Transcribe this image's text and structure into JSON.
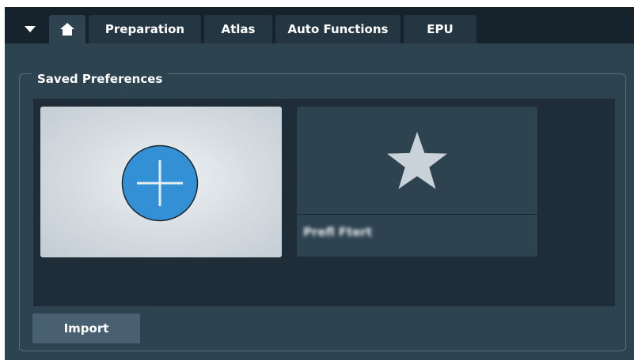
{
  "tabs": {
    "menu_toggle_icon": "caret-down-icon",
    "home_icon": "home-icon",
    "items": [
      {
        "label": "Preparation"
      },
      {
        "label": "Atlas"
      },
      {
        "label": "Auto Functions"
      },
      {
        "label": "EPU"
      }
    ],
    "active": "home"
  },
  "saved_preferences": {
    "title": "Saved Preferences",
    "new_tile_icon": "add-circle-icon",
    "tiles": [
      {
        "icon": "star-icon",
        "name": "Prefl Ftert"
      }
    ]
  },
  "actions": {
    "import_label": "Import"
  },
  "colors": {
    "tab_bar_bg": "#16232d",
    "panel_bg": "#2e4350",
    "tile_area_bg": "#1e2d37",
    "accent_blue": "#3390d5"
  }
}
